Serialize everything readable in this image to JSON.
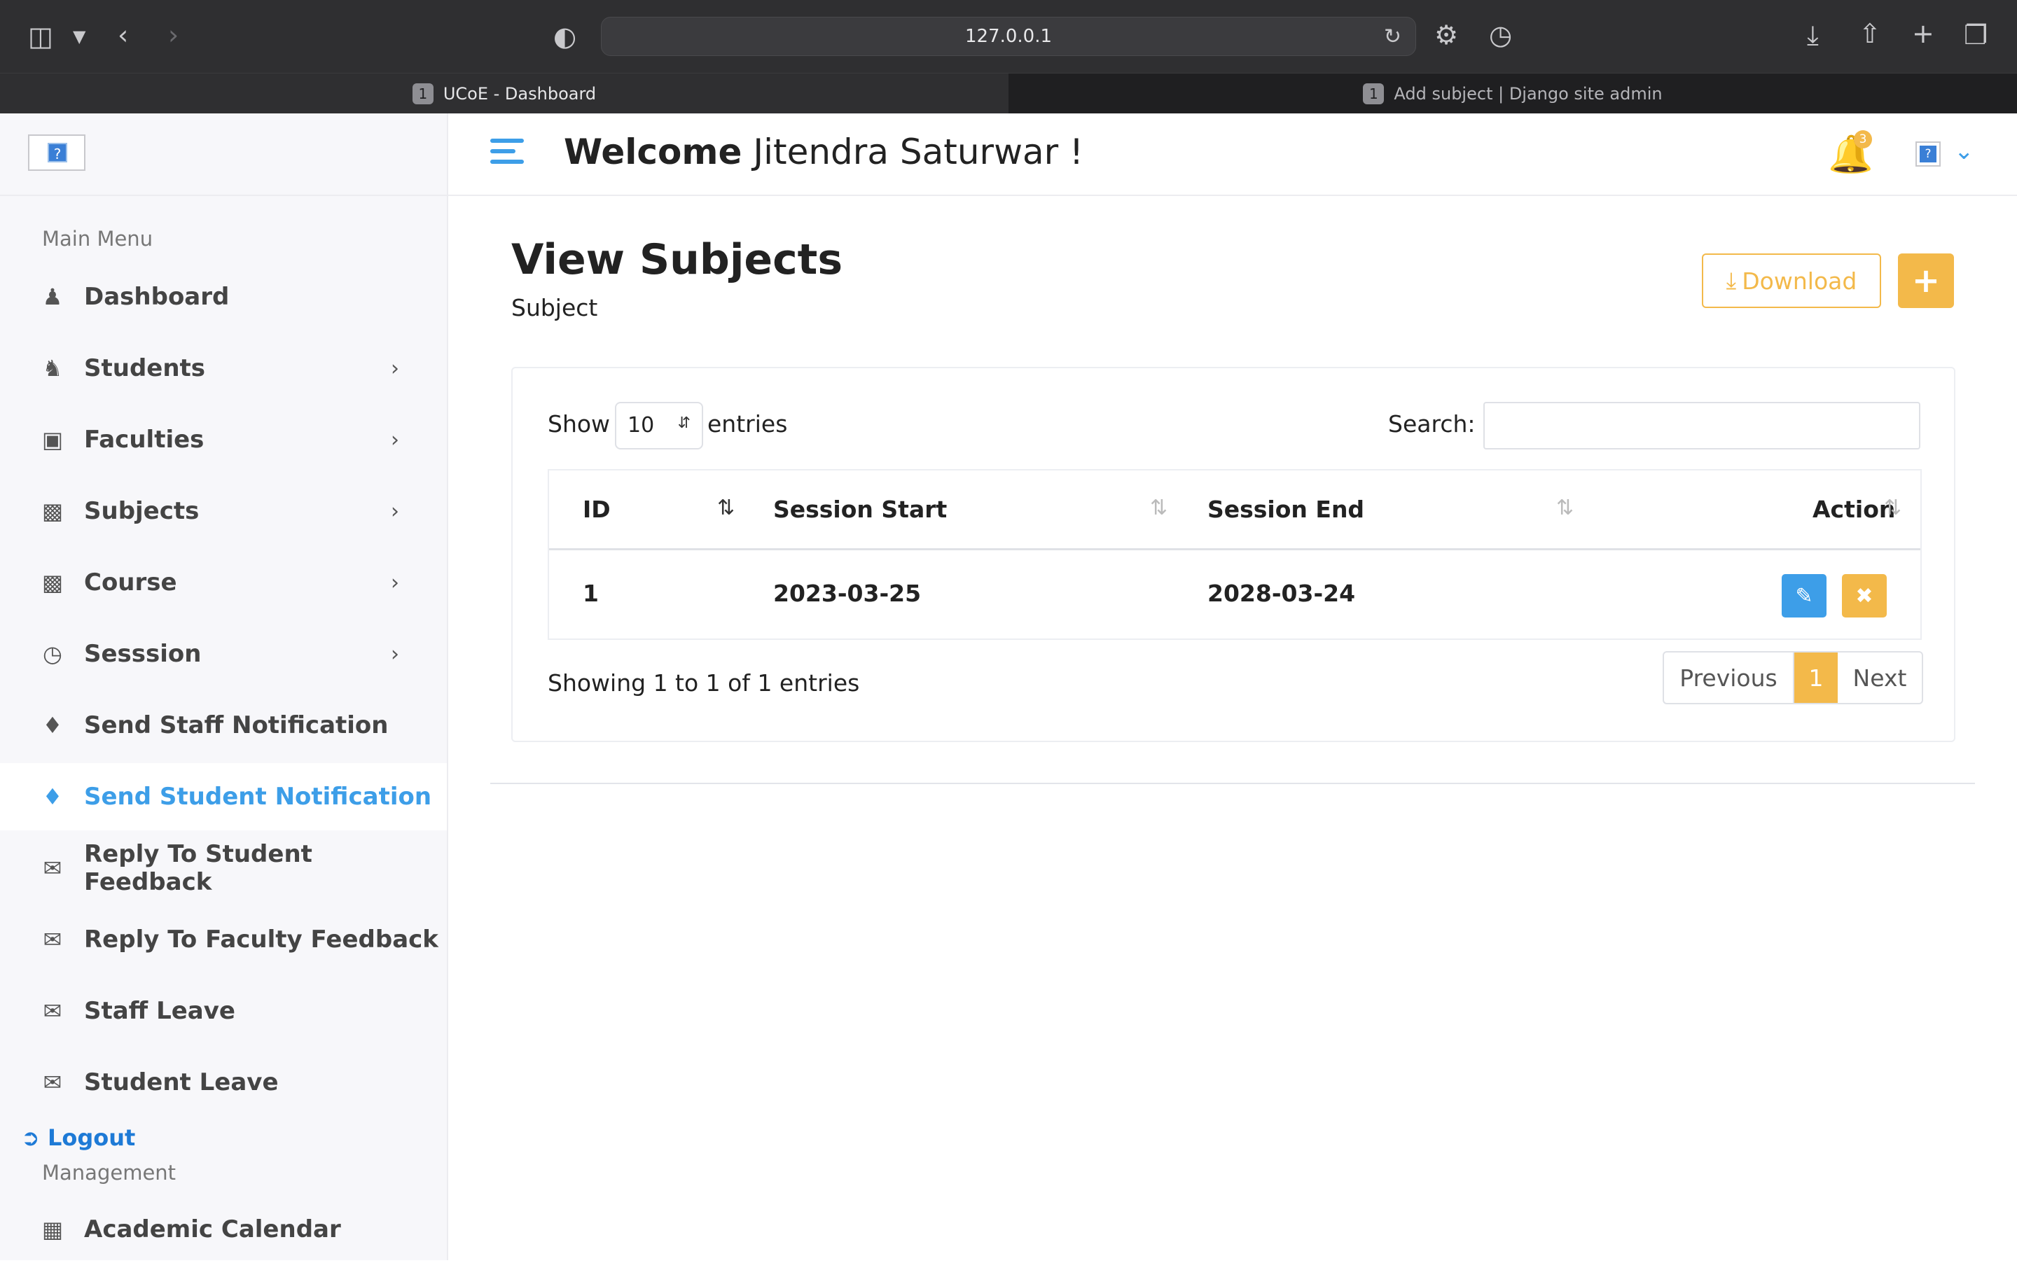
{
  "browser": {
    "url": "127.0.0.1",
    "tabs": [
      {
        "number": "1",
        "title": "UCoE - Dashboard"
      },
      {
        "number": "1",
        "title": "Add subject | Django site admin"
      }
    ]
  },
  "header": {
    "welcome_bold": "Welcome",
    "welcome_name": "Jitendra Saturwar  !",
    "notification_count": "3"
  },
  "sidebar": {
    "main_menu_title": "Main Menu",
    "items": [
      {
        "label": "Dashboard",
        "icon": "dashboard-icon"
      },
      {
        "label": "Students",
        "icon": "student-icon"
      },
      {
        "label": "Faculties",
        "icon": "faculty-icon"
      },
      {
        "label": "Subjects",
        "icon": "subjects-icon"
      },
      {
        "label": "Course",
        "icon": "course-icon"
      },
      {
        "label": "Sesssion",
        "icon": "clock-icon"
      },
      {
        "label": "Send Staff Notification",
        "icon": "bell-icon"
      },
      {
        "label": "Send Student Notification",
        "icon": "bell-icon"
      },
      {
        "label": "Reply To Student Feedback",
        "icon": "comments-icon"
      },
      {
        "label": "Reply To Faculty Feedback",
        "icon": "comments-icon"
      },
      {
        "label": "Staff Leave",
        "icon": "envelope-open-icon"
      },
      {
        "label": "Student Leave",
        "icon": "envelope-open-icon"
      }
    ],
    "logout_label": "Logout",
    "management_title": "Management",
    "calendar_label": "Academic Calendar"
  },
  "main": {
    "title": "View Subjects",
    "breadcrumb": "Subject",
    "download_label": "Download",
    "add_label": "+"
  },
  "table": {
    "show_label": "Show",
    "page_size": "10",
    "entries_label": "entries",
    "search_label": "Search:",
    "search_value": "",
    "columns": [
      "ID",
      "Session Start",
      "Session End",
      "Action"
    ],
    "rows": [
      {
        "id": "1",
        "session_start": "2023-03-25",
        "session_end": "2028-03-24"
      }
    ],
    "showing_text": "Showing 1 to 1 of 1 entries",
    "previous_label": "Previous",
    "current_page": "1",
    "next_label": "Next"
  },
  "colors": {
    "accent_blue": "#3d9ee8",
    "accent_yellow": "#f3b94a"
  }
}
